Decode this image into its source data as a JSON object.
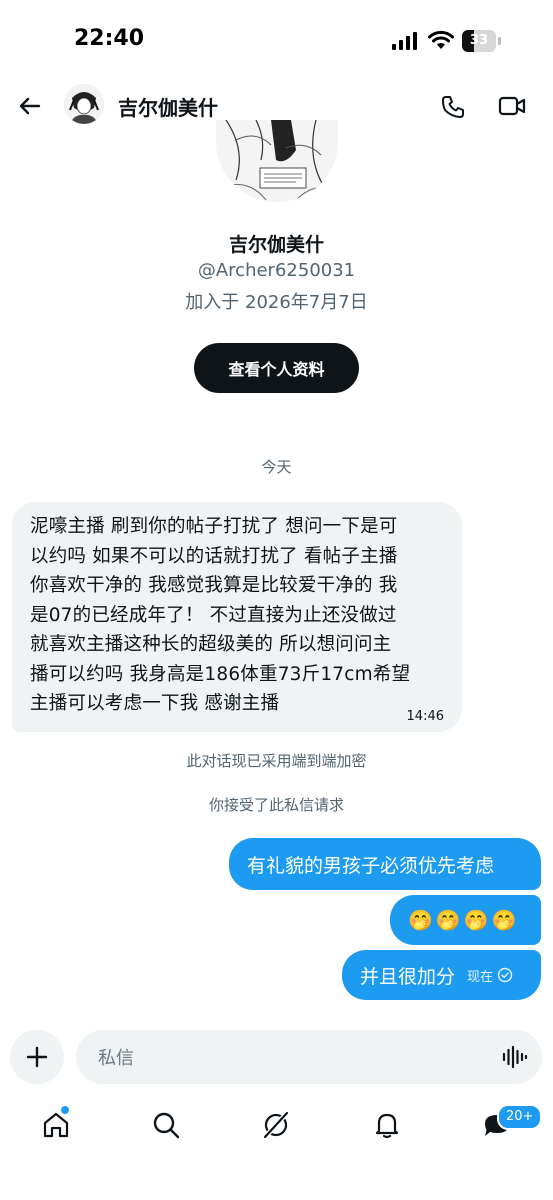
{
  "status_bar": {
    "time": "22:40",
    "battery": "33"
  },
  "header": {
    "name": "吉尔伽美什"
  },
  "profile": {
    "name": "吉尔伽美什",
    "handle": "@Archer6250031",
    "joined": "加入于 2026年7月7日",
    "view_profile_label": "查看个人资料"
  },
  "conversation": {
    "date_separator": "今天",
    "incoming": {
      "lines": [
        "泥嚎主播 刷到你的帖子打扰了 想问一下是可",
        "以约吗 如果不可以的话就打扰了 看帖子主播",
        "你喜欢干净的 我感觉我算是比较爱干净的 我",
        "是07的已经成年了！ 不过直接为止还没做过",
        "就喜欢主播这种长的超级美的 所以想问问主",
        "播可以约吗 我身高是186体重73斤17cm希望",
        "主播可以考虑一下我 感谢主播"
      ],
      "time": "14:46"
    },
    "encryption_note": "此对话现已采用端到端加密",
    "accepted_note": "你接受了此私信请求",
    "outgoing": [
      {
        "text": "有礼貌的男孩子必须优先考虑"
      },
      {
        "text": "🤭🤭🤭🤭"
      },
      {
        "text": "并且很加分",
        "time": "现在"
      }
    ]
  },
  "composer": {
    "placeholder": "私信"
  },
  "bottom_nav": {
    "messages_badge": "20+"
  },
  "colors": {
    "accent": "#1d9bf0",
    "bubble_in": "#eff3f4",
    "text": "#0f1419",
    "muted": "#536471"
  }
}
